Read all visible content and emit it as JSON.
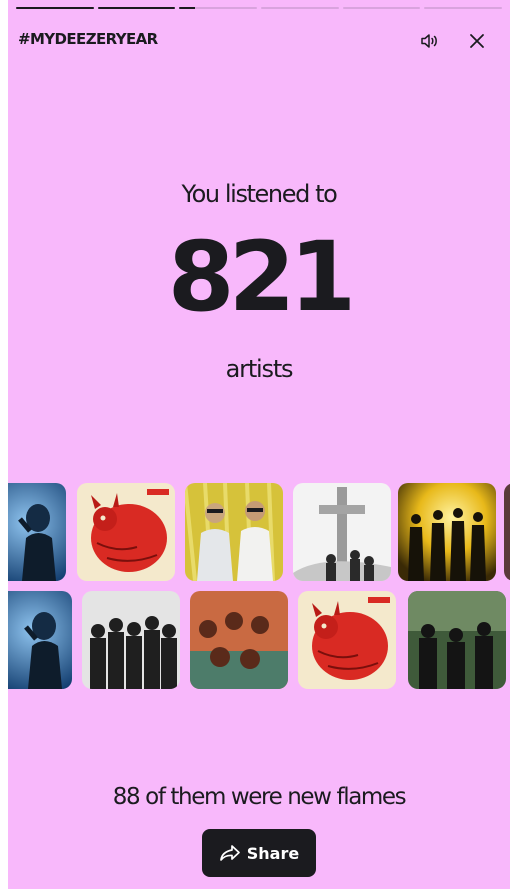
{
  "header": {
    "hashtag": "#MYDEEZERYEAR",
    "sound_icon": "speaker-icon",
    "close_icon": "close-icon"
  },
  "progress": {
    "segments": 6,
    "completed": 2,
    "current_fill": 0.2
  },
  "stats": {
    "headline": "You listened to",
    "count": "821",
    "unit": "artists",
    "new_count_text": "88 of them were new flames"
  },
  "share": {
    "label": "Share",
    "icon": "share-arrow-icon"
  },
  "colors": {
    "background": "#f8b8fb",
    "text": "#1b1b1f",
    "button": "#1b1b1f",
    "button_text": "#ffffff"
  },
  "artist_rows": [
    [
      "concert-singer-photo",
      "red-demon-album-cover",
      "two-men-yellow-wall-photo",
      "cross-monument-photo",
      "band-silhouette-yellow-photo",
      "partial-artist-photo"
    ],
    [
      "concert-singer-photo",
      "band-black-white-photo",
      "band-orange-tint-photo",
      "red-demon-album-cover",
      "band-outdoor-photo"
    ]
  ]
}
